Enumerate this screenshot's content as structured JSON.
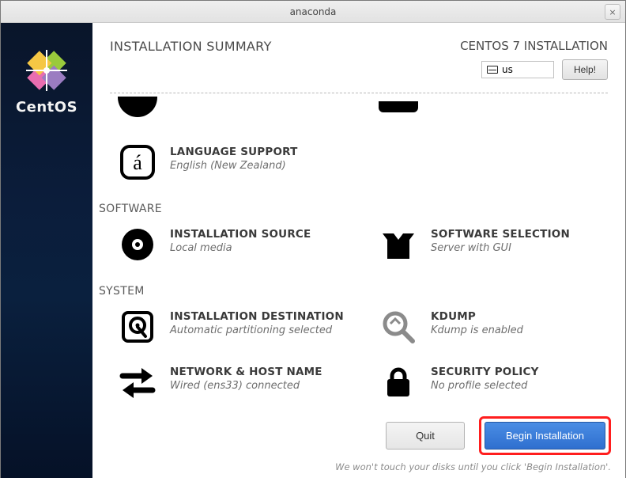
{
  "window": {
    "title": "anaconda",
    "close_glyph": "×"
  },
  "sidebar": {
    "product": "CentOS"
  },
  "header": {
    "page_title": "INSTALLATION SUMMARY",
    "brand": "CENTOS 7 INSTALLATION",
    "keyboard": "us",
    "help_label": "Help!"
  },
  "categories": {
    "software": "SOFTWARE",
    "system": "SYSTEM"
  },
  "spokes": {
    "language_support": {
      "title": "LANGUAGE SUPPORT",
      "sub": "English (New Zealand)"
    },
    "installation_source": {
      "title": "INSTALLATION SOURCE",
      "sub": "Local media"
    },
    "software_selection": {
      "title": "SOFTWARE SELECTION",
      "sub": "Server with GUI"
    },
    "installation_destination": {
      "title": "INSTALLATION DESTINATION",
      "sub": "Automatic partitioning selected"
    },
    "kdump": {
      "title": "KDUMP",
      "sub": "Kdump is enabled"
    },
    "network": {
      "title": "NETWORK & HOST NAME",
      "sub": "Wired (ens33) connected"
    },
    "security": {
      "title": "SECURITY POLICY",
      "sub": "No profile selected"
    }
  },
  "footer": {
    "quit_label": "Quit",
    "begin_label": "Begin Installation",
    "hint": "We won't touch your disks until you click 'Begin Installation'."
  },
  "icons": {
    "language": "language-a-icon",
    "disc": "optical-disc-icon",
    "package": "package-open-icon",
    "disk": "hard-disk-icon",
    "magnifier": "magnifier-icon",
    "network": "network-arrows-icon",
    "lock": "lock-icon"
  }
}
